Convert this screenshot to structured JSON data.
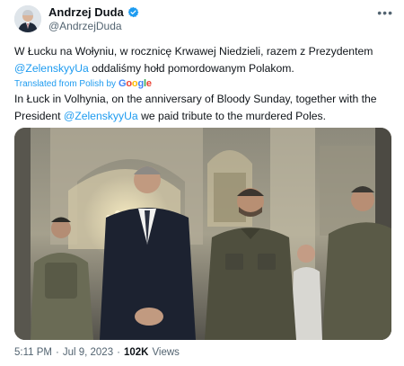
{
  "author": {
    "name": "Andrzej Duda",
    "handle": "@AndrzejDuda"
  },
  "tweet": {
    "polish_line1": "W Łucku na Wołyniu, w rocznicę Krwawej Niedzieli, razem z Prezydentem",
    "polish_mention": "@ZelenskyyUa",
    "polish_line2_rest": " oddaliśmy hołd pomordowanym Polakom.",
    "translated_label": "Translated from Polish by",
    "google_label": "Google",
    "english_part1": "In Łuck in Volhynia, on the anniversary of Bloody Sunday, together with the President ",
    "english_mention": "@ZelenskyyUa",
    "english_part2": " we paid tribute to the murdered Poles."
  },
  "meta": {
    "time": "5:11 PM",
    "separator1": "·",
    "date": "Jul 9, 2023",
    "separator2": "·",
    "views_count": "102K",
    "views_label": "Views"
  },
  "colors": {
    "link": "#1d9bf0",
    "verified": "#1d9bf0"
  },
  "icons": {
    "verified": "verified-badge-icon",
    "more": "more-options-icon"
  }
}
